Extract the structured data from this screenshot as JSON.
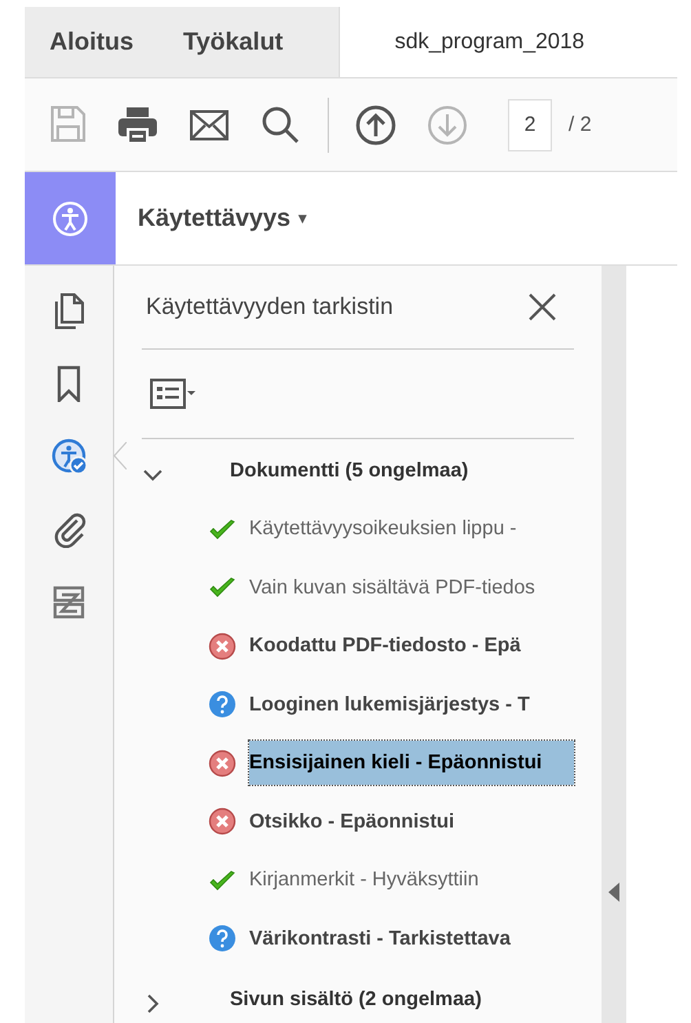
{
  "tabs": [
    {
      "label": "Aloitus",
      "selected": false
    },
    {
      "label": "Työkalut",
      "selected": false
    },
    {
      "label": "sdk_program_2018",
      "selected": true
    }
  ],
  "toolbar": {
    "buttons": [
      {
        "kind": "save",
        "disabled": true
      },
      {
        "kind": "print",
        "disabled": false
      },
      {
        "kind": "mail",
        "disabled": false
      },
      {
        "kind": "search",
        "disabled": false
      },
      {
        "kind": "separator"
      },
      {
        "kind": "up",
        "disabled": false
      },
      {
        "kind": "down",
        "disabled": true
      }
    ],
    "page_field": {
      "value": "2"
    },
    "page_total": "/ 2"
  },
  "tool_header": {
    "title": "Käytettävyys",
    "caret": "▾"
  },
  "rail": [
    {
      "kind": "pages",
      "selected": false
    },
    {
      "kind": "bookmark",
      "selected": false
    },
    {
      "kind": "accessibility",
      "selected": true
    },
    {
      "kind": "attachment",
      "selected": false
    },
    {
      "kind": "compare",
      "selected": false
    }
  ],
  "panel": {
    "title": "Käytettävyyden tarkistin",
    "tree": [
      {
        "label": "Dokumentti (5 ongelmaa)",
        "expanded": true,
        "children": [
          {
            "label": "Käytettävyysoikeuksien lippu -",
            "kind": "pass",
            "selected": false
          },
          {
            "label": "Vain kuvan sisältävä PDF-tiedos",
            "kind": "pass",
            "selected": false
          },
          {
            "label": "Koodattu PDF-tiedosto - Epä",
            "kind": "fail",
            "selected": false
          },
          {
            "label": "Looginen lukemisjärjestys - T",
            "kind": "review",
            "selected": false
          },
          {
            "label": "Ensisijainen kieli - Epäonnistui",
            "kind": "fail",
            "selected": true
          },
          {
            "label": "Otsikko - Epäonnistui",
            "kind": "fail",
            "selected": false
          },
          {
            "label": "Kirjanmerkit - Hyväksyttiin",
            "kind": "pass",
            "selected": false
          },
          {
            "label": "Värikontrasti - Tarkistettava",
            "kind": "review",
            "selected": false
          }
        ]
      },
      {
        "label": "Sivun sisältö (2 ongelmaa)",
        "expanded": false
      }
    ]
  }
}
